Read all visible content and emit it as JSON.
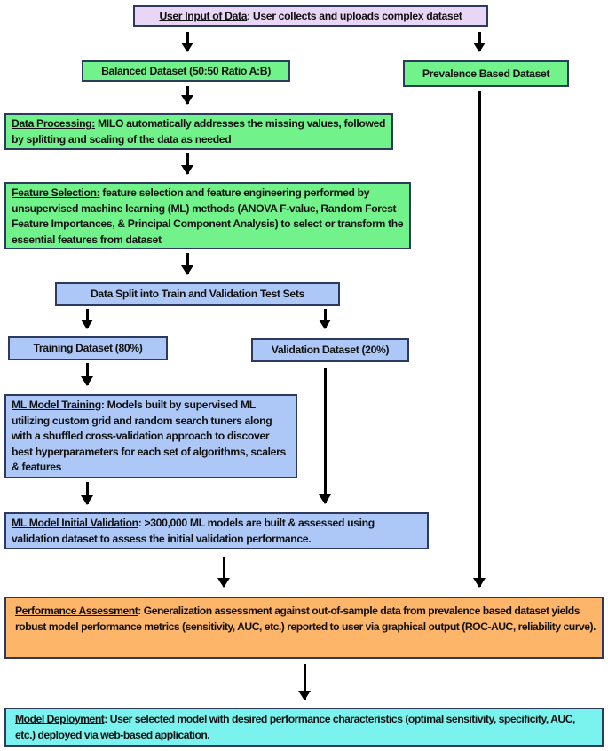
{
  "nodes": {
    "user_input": {
      "title": "User Input of Data",
      "sep": ":",
      "text": " User collects and uploads complex dataset"
    },
    "balanced": {
      "text": "Balanced Dataset (50:50 Ratio A:B)"
    },
    "prevalence": {
      "text": "Prevalence Based Dataset"
    },
    "processing": {
      "title": "Data Processing:",
      "text": " MILO automatically addresses the missing values, followed by splitting and scaling of the data as needed"
    },
    "feature_selection": {
      "title": "Feature Selection:",
      "text": " feature selection and feature engineering performed by unsupervised machine learning (ML)  methods (ANOVA F-value, Random Forest Feature Importances, & Principal Component Analysis) to select or transform the essential features from dataset"
    },
    "split": {
      "text": "Data Split into Train and Validation Test Sets"
    },
    "training_dataset": {
      "text": "Training Dataset (80%)"
    },
    "validation_dataset": {
      "text": "Validation Dataset (20%)"
    },
    "model_training": {
      "title": "ML Model Training",
      "sep": ":",
      "text": " Models built by supervised ML utilizing custom grid and random search tuners along with a shuffled cross-validation approach  to discover best hyperparameters for each set of algorithms, scalers & features"
    },
    "initial_validation": {
      "title": "ML Model Initial Validation",
      "sep": ":",
      "text": " >300,000 ML models are built & assessed using validation dataset to assess the initial validation performance."
    },
    "performance": {
      "title": "Performance Assessment",
      "sep": ":",
      "text": " Generalization assessment against out-of-sample data from prevalence based dataset yields robust model performance metrics  (sensitivity, AUC, etc.) reported to user via graphical output (ROC-AUC, reliability curve)."
    },
    "deployment": {
      "title": "Model Deployment",
      "sep": ":",
      "text": " User selected model with desired performance characteristics (optimal sensitivity, specificity, AUC, etc.) deployed via web-based application."
    }
  },
  "colors": {
    "user_input": "#e9d5f5",
    "dataset_processing": "#72f28a",
    "training_validation": "#adc8f7",
    "performance": "#fdb56a",
    "deployment": "#7af3ef",
    "border": "#2b3a5e"
  }
}
